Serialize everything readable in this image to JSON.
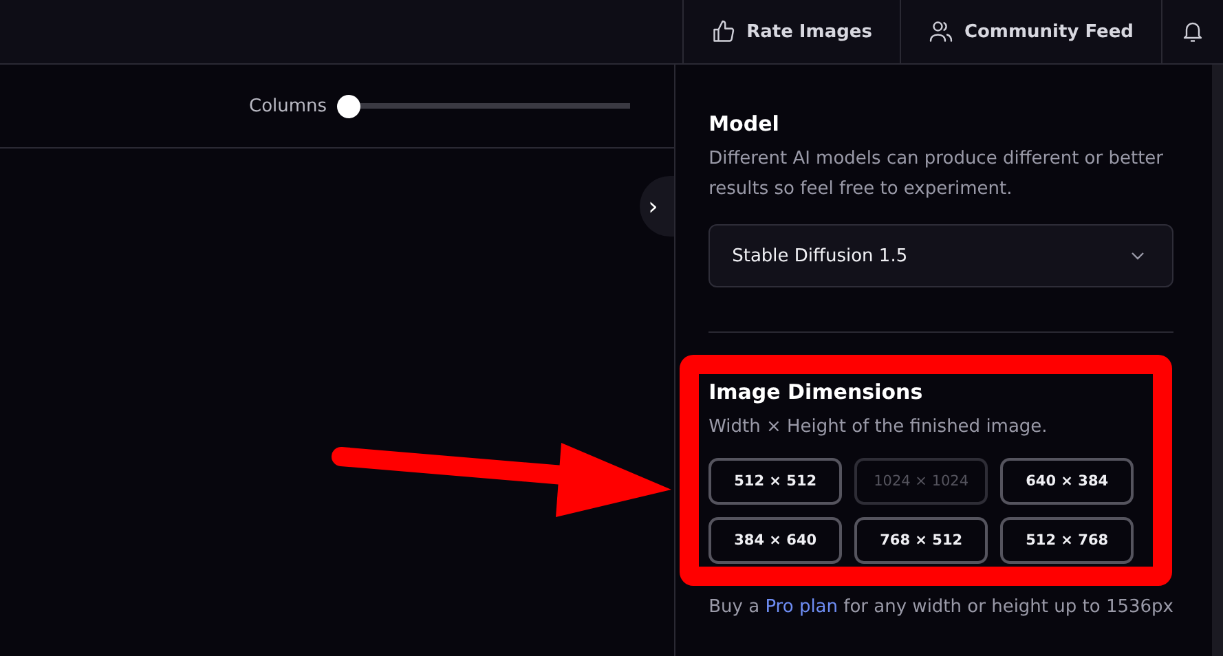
{
  "top_bar": {
    "buttons": [
      {
        "kind": "thumb",
        "label": "Rate Images"
      },
      {
        "kind": "people",
        "label": "Community Feed"
      },
      {
        "kind": "bell"
      }
    ]
  },
  "toolbar": {
    "columns_slider": {
      "label": "Columns",
      "level": 0
    }
  },
  "collapse_button": {
    "glyph": "›"
  },
  "model": {
    "title": "Model",
    "description": "Different AI models can produce different or better results so feel free to experiment.",
    "value": "Stable Diffusion 1.5"
  },
  "dimensions": {
    "title": "Image Dimensions",
    "description": "Width × Height of the finished image.",
    "options": [
      {
        "label": "512 × 512",
        "disabled": false
      },
      {
        "label": "1024 × 1024",
        "disabled": true
      },
      {
        "label": "640 × 384",
        "disabled": false
      },
      {
        "label": "384 × 640",
        "disabled": false
      },
      {
        "label": "768 × 512",
        "disabled": false
      },
      {
        "label": "512 × 768",
        "disabled": false
      }
    ],
    "hint": {
      "before": "Buy a ",
      "link": "Pro plan",
      "after": " for any width or height up to 1536px"
    }
  }
}
